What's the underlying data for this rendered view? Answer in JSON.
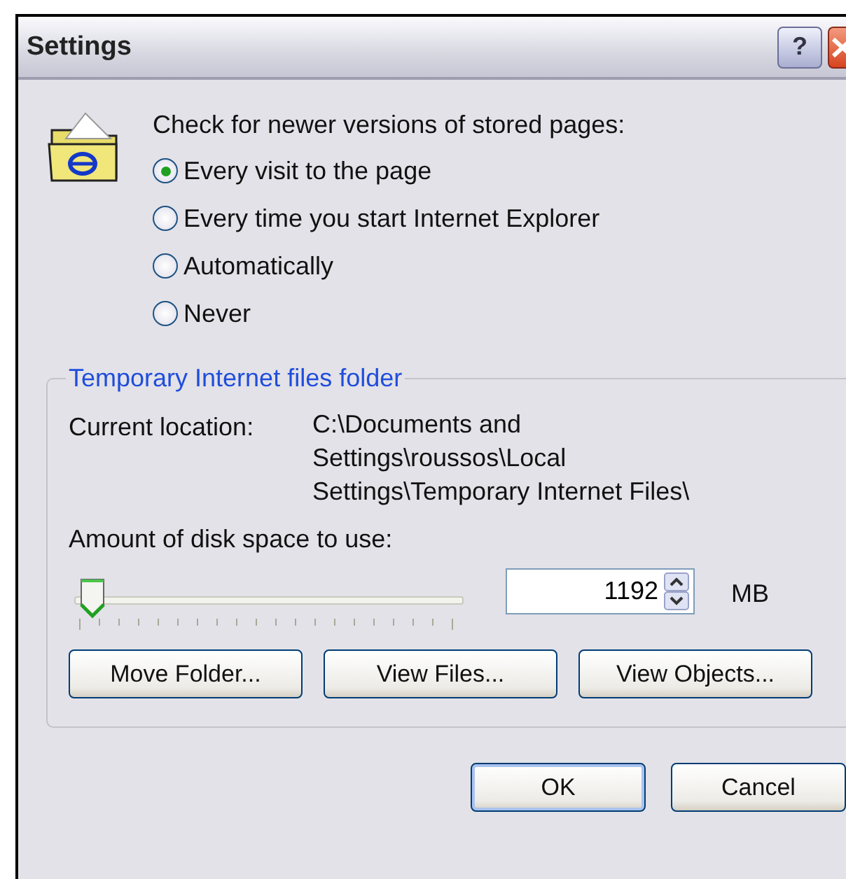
{
  "window": {
    "title": "Settings",
    "title_buttons": [
      "?"
    ]
  },
  "check": {
    "heading": "Check for newer versions of stored pages:",
    "options": [
      {
        "label": "Every visit to the page",
        "selected": true
      },
      {
        "label": "Every time you start Internet Explorer",
        "selected": false
      },
      {
        "label": "Automatically",
        "selected": false
      },
      {
        "label": "Never",
        "selected": false
      }
    ]
  },
  "folder_group": {
    "legend": "Temporary Internet files folder",
    "location_label": "Current location:",
    "location_lines": [
      "C:\\Documents and",
      "Settings\\roussos\\Local",
      "Settings\\Temporary Internet Files\\"
    ],
    "space_label": "Amount of disk space to use:",
    "space": {
      "value": "1192",
      "unit": "MB"
    },
    "buttons": [
      "Move Folder...",
      "View Files...",
      "View Objects..."
    ]
  },
  "buttons": [
    "OK",
    "Cancel"
  ]
}
